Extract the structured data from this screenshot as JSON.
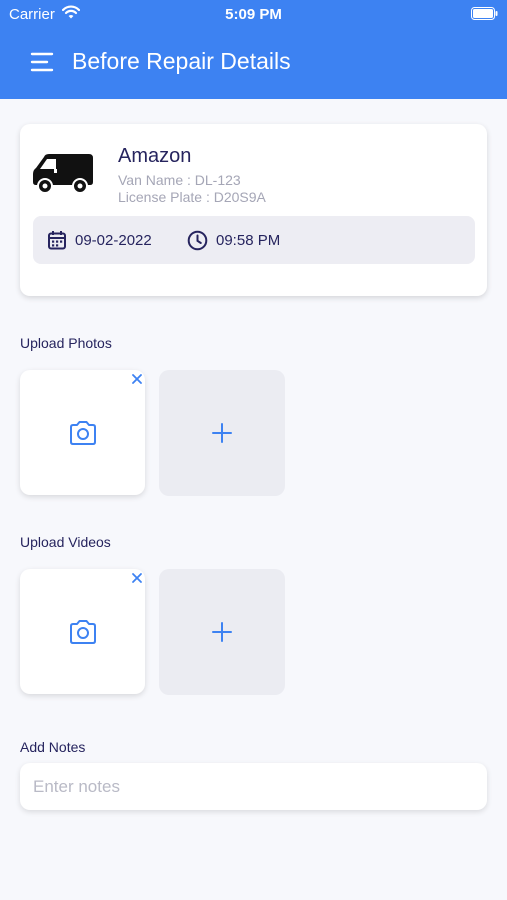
{
  "status_bar": {
    "carrier": "Carrier",
    "time": "5:09 PM"
  },
  "header": {
    "title": "Before Repair Details",
    "background_color": "#3d82f2"
  },
  "van_card": {
    "company": "Amazon",
    "van_name": "Van Name : DL-123",
    "license_plate": "License Plate : D20S9A",
    "date": "09-02-2022",
    "time": "09:58 PM"
  },
  "upload_photos": {
    "label": "Upload Photos"
  },
  "upload_videos": {
    "label": "Upload Videos"
  },
  "notes": {
    "label": "Add Notes",
    "placeholder": "Enter notes",
    "value": ""
  },
  "icons": {
    "menu": "hamburger-menu-icon",
    "van": "van-icon",
    "calendar": "calendar-icon",
    "clock": "clock-icon",
    "camera": "camera-icon",
    "remove": "close-icon",
    "add": "plus-icon"
  },
  "colors": {
    "accent": "#3d82f2",
    "text_dark": "#26245e",
    "text_muted": "#a5a6b6"
  }
}
